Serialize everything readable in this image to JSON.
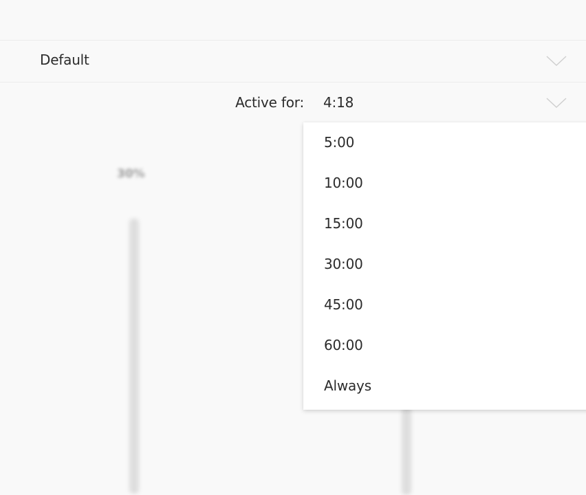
{
  "profile_select": {
    "value": "Default",
    "chevron_icon": "chevron-down-icon"
  },
  "active_for": {
    "label": "Active for:",
    "value": "4:18",
    "chevron_icon": "chevron-down-icon"
  },
  "dropdown": {
    "options": [
      "5:00",
      "10:00",
      "15:00",
      "30:00",
      "45:00",
      "60:00",
      "Always"
    ]
  },
  "colors": {
    "background": "#f9f9f9",
    "text": "#2b2b2b",
    "chevron": "#cfcfcf",
    "dropdown_bg": "#ffffff"
  }
}
